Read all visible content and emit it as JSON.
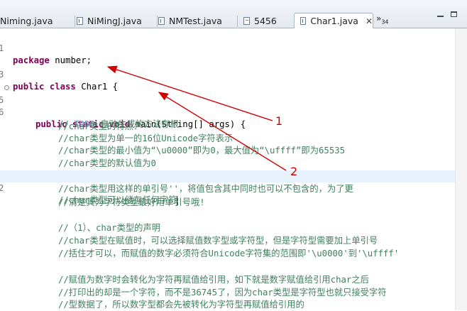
{
  "tabs": [
    {
      "label": "Niming.java",
      "active": false
    },
    {
      "label": "NiMingJ.java",
      "active": false
    },
    {
      "label": "NMTest.java",
      "active": false
    },
    {
      "label": "5456",
      "active": false
    },
    {
      "label": "Char1.java",
      "active": true
    }
  ],
  "tab_close": "✕",
  "overflow": {
    "chevron": "»",
    "count": "34"
  },
  "editor": {
    "line_numbers": [
      "1",
      "",
      "3",
      "",
      "5",
      "6",
      "",
      "",
      "",
      "",
      "",
      "2",
      "",
      "",
      "",
      "",
      "",
      "",
      "",
      "",
      "",
      "",
      "",
      ""
    ],
    "pkg_kw": "package",
    "pkg_rest": " number;",
    "class_kw": "public class",
    "class_rest": " Char1 {",
    "main_kw": "public static void",
    "main_rest": " main(String[] args) {",
    "todo_pre": "// ",
    "todo_tag": "TODO",
    "todo_rest": " 自动生成的方法存根",
    "comments": [
      "//char类型的特点：",
      "//char类型为单一的16位Unicode字符表示",
      "//char类型的最小值为“\\u0000”即为0，最大值为“\\uffff”即为65535",
      "//char类型的默认值为0",
      "//char类型可以储存任何字符",
      "//char类型用这样的单引号''，将值包含其中同时也可以不包含的，为了更",
      "//清楚其为字符类型最好用单引号哦!",
      "//（1）、char类型的声明",
      "//char类型在赋值时，可以选择赋值数字型或字符型，但是字符型需要加上单引号",
      "//括住才可以，而赋值的数字必须符合Unicode字符集的范围即'\\u0000'到'\\uffff'",
      "//赋值为数字时会转化为字符再赋值给引用，如下就是数字赋值给引用char之后",
      "//打印出的却是一个字符，而不是36745了，因为char类型是字符型也就只接受字符",
      "//型数据了，所以数字型都会先被转化为字符型再赋值给引用的"
    ]
  },
  "annotations": {
    "label1": "1",
    "label2": "2"
  },
  "colors": {
    "keyword": "#7f0055",
    "comment": "#3f7f5f",
    "todo": "#7f9fbf",
    "annotation": "#d00000",
    "current_line": "#e8f2fe"
  }
}
